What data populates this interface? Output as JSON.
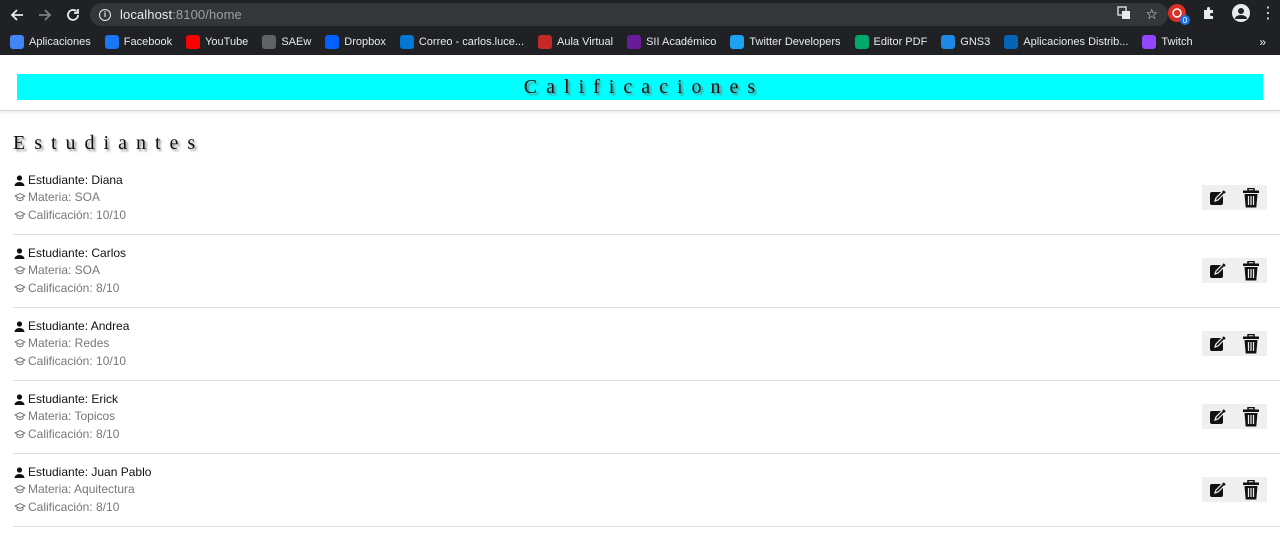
{
  "browser": {
    "url_host": "localhost",
    "url_path": ":8100/home",
    "back_icon": "arrow-left-icon",
    "forward_icon": "arrow-right-icon",
    "reload_icon": "reload-icon",
    "extension_badge": "0"
  },
  "bookmarks": [
    {
      "label": "Aplicaciones",
      "icon": "apps-grid-icon",
      "color": "#4285f4"
    },
    {
      "label": "Facebook",
      "icon": "facebook-icon",
      "color": "#1877f2"
    },
    {
      "label": "YouTube",
      "icon": "youtube-icon",
      "color": "#ff0000"
    },
    {
      "label": "SAEw",
      "icon": "saew-icon",
      "color": "#5f6368"
    },
    {
      "label": "Dropbox",
      "icon": "dropbox-icon",
      "color": "#0061ff"
    },
    {
      "label": "Correo - carlos.luce...",
      "icon": "outlook-icon",
      "color": "#0078d4"
    },
    {
      "label": "Aula Virtual",
      "icon": "aula-virtual-icon",
      "color": "#c62828"
    },
    {
      "label": "SII Académico",
      "icon": "sii-icon",
      "color": "#6a1b9a"
    },
    {
      "label": "Twitter Developers",
      "icon": "twitter-icon",
      "color": "#1da1f2"
    },
    {
      "label": "Editor PDF",
      "icon": "editor-pdf-icon",
      "color": "#00a86b"
    },
    {
      "label": "GNS3",
      "icon": "gns3-icon",
      "color": "#1e88e5"
    },
    {
      "label": "Aplicaciones Distrib...",
      "icon": "onedrive-icon",
      "color": "#0364b8"
    },
    {
      "label": "Twitch",
      "icon": "twitch-icon",
      "color": "#9146ff"
    }
  ],
  "bookmarks_more": "»",
  "header": {
    "title": "Calificaciones",
    "title_bg": "#00ffff"
  },
  "section": {
    "title": "Estudiantes"
  },
  "students": [
    {
      "estudiante": "Estudiante: Diana",
      "materia": "Materia: SOA",
      "calificacion": "Calificación: 10/10"
    },
    {
      "estudiante": "Estudiante: Carlos",
      "materia": "Materia: SOA",
      "calificacion": "Calificación: 8/10"
    },
    {
      "estudiante": "Estudiante: Andrea",
      "materia": "Materia: Redes",
      "calificacion": "Calificación: 10/10"
    },
    {
      "estudiante": "Estudiante: Erick",
      "materia": "Materia: Topicos",
      "calificacion": "Calificación: 8/10"
    },
    {
      "estudiante": "Estudiante: Juan Pablo",
      "materia": "Materia: Aquitectura",
      "calificacion": "Calificación: 8/10"
    }
  ]
}
